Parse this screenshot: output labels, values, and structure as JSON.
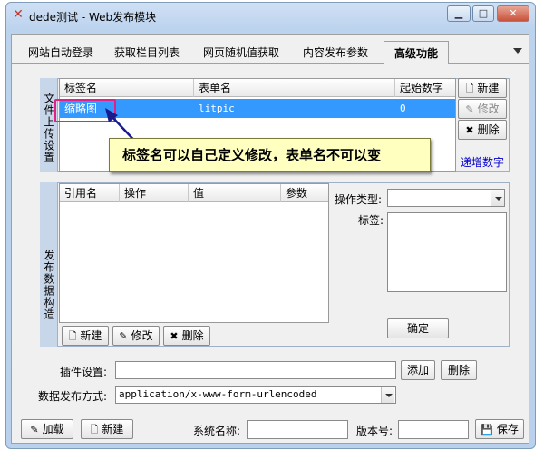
{
  "window": {
    "title": "dede测试 - Web发布模块"
  },
  "tabs": [
    {
      "label": "网站自动登录"
    },
    {
      "label": "获取栏目列表"
    },
    {
      "label": "网页随机值获取"
    },
    {
      "label": "内容发布参数"
    },
    {
      "label": "高级功能"
    }
  ],
  "upload_group": {
    "label": "文件上传设置",
    "columns": [
      "标签名",
      "表单名",
      "起始数字"
    ],
    "rows": [
      {
        "tag": "缩略图",
        "form": "litpic",
        "start": "0"
      }
    ],
    "buttons": {
      "new": "新建",
      "edit": "修改",
      "delete": "删除"
    },
    "increment_link": "递增数字"
  },
  "callout": {
    "text": "标签名可以自己定义修改，表单名不可以变"
  },
  "publish_group": {
    "label": "发布数据构造",
    "columns": [
      "引用名",
      "操作",
      "值",
      "参数"
    ],
    "buttons": {
      "new": "新建",
      "edit": "修改",
      "delete": "删除"
    },
    "op_type_label": "操作类型:",
    "tag_label": "标签:",
    "confirm": "确定"
  },
  "plugin": {
    "label": "插件设置:",
    "add": "添加",
    "delete": "删除"
  },
  "data_method": {
    "label": "数据发布方式:",
    "value": "application/x-www-form-urlencoded"
  },
  "footer": {
    "load": "加载",
    "new": "新建",
    "system_name_label": "系统名称:",
    "version_label": "版本号:",
    "save": "保存"
  }
}
